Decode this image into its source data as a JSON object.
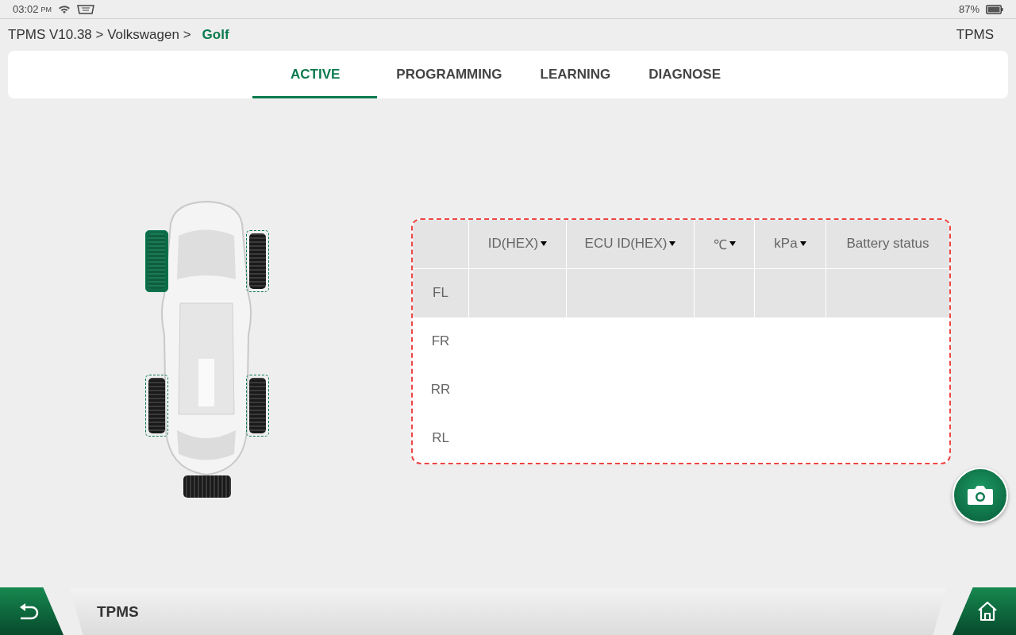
{
  "status_bar": {
    "time": "03:02",
    "ampm": "PM",
    "battery": "87%"
  },
  "breadcrumb": {
    "path": "TPMS V10.38 > Volkswagen >",
    "current": "Golf",
    "right_label": "TPMS"
  },
  "tabs": [
    {
      "label": "ACTIVE",
      "selected": true
    },
    {
      "label": "PROGRAMMING",
      "selected": false
    },
    {
      "label": "LEARNING",
      "selected": false
    },
    {
      "label": "DIAGNOSE",
      "selected": false
    }
  ],
  "wheels": [
    {
      "selected": true
    },
    {
      "selected": false
    },
    {
      "selected": false
    },
    {
      "selected": false
    }
  ],
  "table": {
    "columns": [
      {
        "label": "ID(HEX)",
        "menu": true
      },
      {
        "label": "ECU ID(HEX)",
        "menu": true
      },
      {
        "label": "℃",
        "menu": true
      },
      {
        "label": "kPa",
        "menu": true
      },
      {
        "label": "Battery status",
        "menu": false
      }
    ],
    "rows": [
      {
        "label": "FL",
        "selected": true
      },
      {
        "label": "FR",
        "selected": false
      },
      {
        "label": "RR",
        "selected": false
      },
      {
        "label": "RL",
        "selected": false
      }
    ]
  },
  "footer": {
    "title": "TPMS"
  }
}
